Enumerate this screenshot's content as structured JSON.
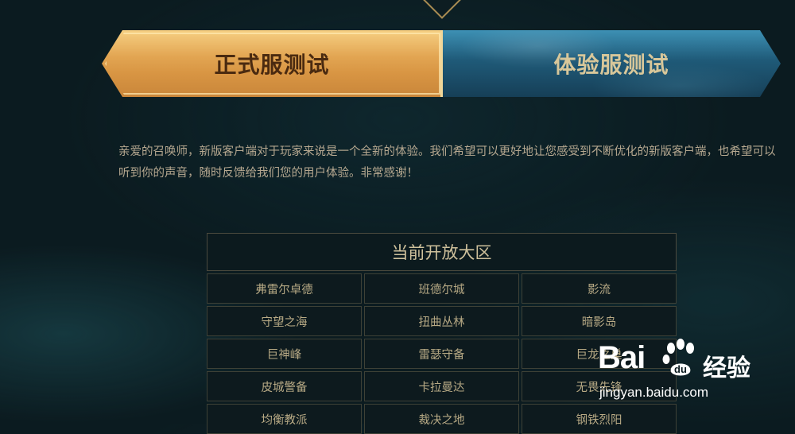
{
  "tabs": {
    "formal_label": "正式服测试",
    "experience_label": "体验服测试"
  },
  "intro": {
    "text": "亲爱的召唤师，新版客户端对于玩家来说是一个全新的体验。我们希望可以更好地让您感受到不断优化的新版客户端，也希望可以听到你的声音，随时反馈给我们您的用户体验。非常感谢！"
  },
  "servers": {
    "title": "当前开放大区",
    "items": [
      {
        "label": "弗雷尔卓德"
      },
      {
        "label": "班德尔城"
      },
      {
        "label": "影流"
      },
      {
        "label": "守望之海"
      },
      {
        "label": "扭曲丛林"
      },
      {
        "label": "暗影岛"
      },
      {
        "label": "巨神峰"
      },
      {
        "label": "雷瑟守备"
      },
      {
        "label": "巨龙之巢"
      },
      {
        "label": "皮城警备"
      },
      {
        "label": "卡拉曼达"
      },
      {
        "label": "无畏先锋"
      },
      {
        "label": "均衡教派"
      },
      {
        "label": "裁决之地"
      },
      {
        "label": "钢铁烈阳"
      }
    ]
  },
  "watermark": {
    "brand": "Bai",
    "brand_cn": "经验",
    "url": "jingyan.baidu.com"
  }
}
